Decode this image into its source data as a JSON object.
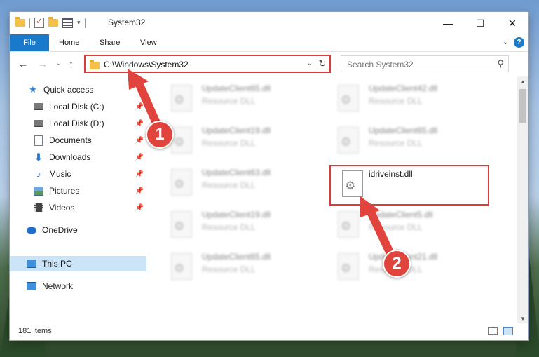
{
  "window": {
    "title": "System32",
    "min_symbol": "—",
    "max_symbol": "☐",
    "close_symbol": "✕"
  },
  "ribbon": {
    "tabs": [
      "File",
      "Home",
      "Share",
      "View"
    ],
    "collapse_symbol": "⌄",
    "help_symbol": "?"
  },
  "nav": {
    "back_symbol": "←",
    "forward_symbol": "→",
    "recent_symbol": "⌄",
    "up_symbol": "↑",
    "address": "C:\\Windows\\System32",
    "address_dropdown_symbol": "⌄",
    "refresh_symbol": "↻",
    "search_placeholder": "Search System32",
    "search_symbol": "⚲"
  },
  "sidebar": {
    "items": [
      {
        "label": "Quick access",
        "icon": "star-icon",
        "pinned": false
      },
      {
        "label": "Local Disk (C:)",
        "icon": "drive-icon",
        "pinned": true
      },
      {
        "label": "Local Disk (D:)",
        "icon": "drive-icon",
        "pinned": true
      },
      {
        "label": "Documents",
        "icon": "documents-icon",
        "pinned": true
      },
      {
        "label": "Downloads",
        "icon": "downloads-icon",
        "pinned": true
      },
      {
        "label": "Music",
        "icon": "music-icon",
        "pinned": true
      },
      {
        "label": "Pictures",
        "icon": "pictures-icon",
        "pinned": true
      },
      {
        "label": "Videos",
        "icon": "videos-icon",
        "pinned": true
      },
      {
        "label": "OneDrive",
        "icon": "onedrive-icon",
        "pinned": false
      },
      {
        "label": "This PC",
        "icon": "this-pc-icon",
        "pinned": false,
        "selected": true
      },
      {
        "label": "Network",
        "icon": "network-icon",
        "pinned": false
      }
    ],
    "pin_symbol": "📌"
  },
  "files": [
    {
      "name": "UpdateClient65.dll",
      "type": "Resource DLL"
    },
    {
      "name": "UpdateClient42.dll",
      "type": "Resource DLL"
    },
    {
      "name": "UpdateClient19.dll",
      "type": "Resource DLL"
    },
    {
      "name": "UpdateClient65.dll",
      "type": "Resource DLL"
    },
    {
      "name": "UpdateClient63.dll",
      "type": "Resource DLL"
    },
    {
      "name": "idriveinst.dll",
      "type": ""
    },
    {
      "name": "UpdateClient19.dll",
      "type": "Resource DLL"
    },
    {
      "name": "UpdateClient5.dll",
      "type": "Resource DLL"
    },
    {
      "name": "UpdateClient65.dll",
      "type": "Resource DLL"
    },
    {
      "name": "UpdateClient21.dll",
      "type": "Resource DLL"
    }
  ],
  "status": {
    "item_count": "181 items"
  },
  "callouts": [
    "1",
    "2"
  ],
  "colors": {
    "accent": "#1979ca",
    "highlight": "#d93a3a",
    "selected": "#cce4f7"
  }
}
